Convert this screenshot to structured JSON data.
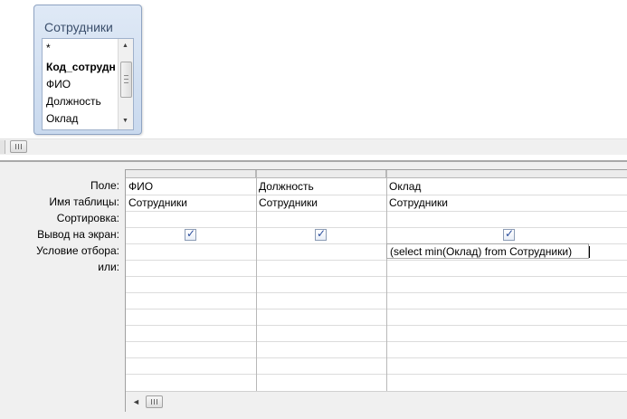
{
  "table": {
    "title": "Сотрудники",
    "fields": [
      {
        "label": "*",
        "key": false
      },
      {
        "label": "Код_сотрудн",
        "key": true
      },
      {
        "label": "ФИО",
        "key": false
      },
      {
        "label": "Должность",
        "key": false
      },
      {
        "label": "Оклад",
        "key": false
      }
    ]
  },
  "grid": {
    "row_labels": {
      "field": "Поле:",
      "table": "Имя таблицы:",
      "sort": "Сортировка:",
      "show": "Вывод на экран:",
      "criteria": "Условие отбора:",
      "or": "или:"
    },
    "columns": [
      {
        "field": "ФИО",
        "table": "Сотрудники",
        "sort": "",
        "show": true,
        "criteria": ""
      },
      {
        "field": "Должность",
        "table": "Сотрудники",
        "sort": "",
        "show": true,
        "criteria": ""
      },
      {
        "field": "Оклад",
        "table": "Сотрудники",
        "sort": "",
        "show": true,
        "criteria": "(select min(Оклад) from Сотрудники)"
      }
    ]
  },
  "icons": {
    "checkbox_checked": "checkbox-checked-icon",
    "scroll_thumb": "scroll-thumb-grip-icon"
  }
}
